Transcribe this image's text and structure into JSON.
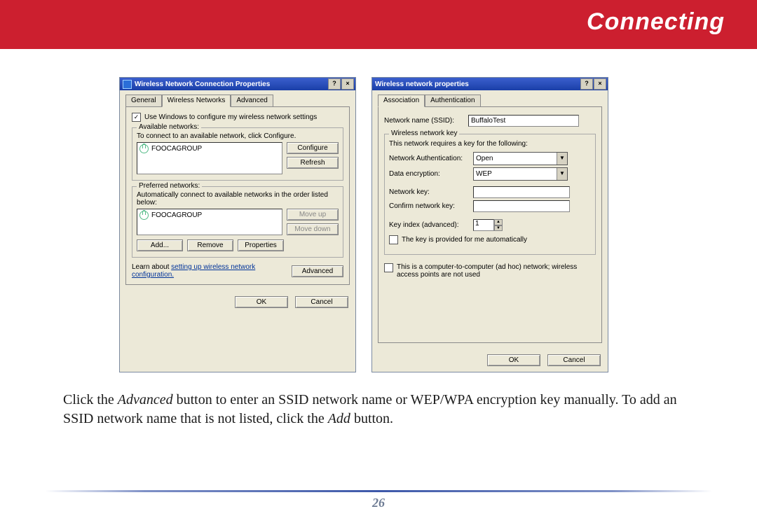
{
  "header": {
    "title": "Connecting"
  },
  "dialog1": {
    "title": "Wireless Network Connection Properties",
    "tabs": {
      "general": "General",
      "wireless": "Wireless Networks",
      "advanced": "Advanced"
    },
    "use_windows_label": "Use Windows to configure my wireless network settings",
    "available": {
      "group_title": "Available networks:",
      "hint": "To connect to an available network, click Configure.",
      "item": "FOOCAGROUP",
      "btn_configure": "Configure",
      "btn_refresh": "Refresh"
    },
    "preferred": {
      "group_title": "Preferred networks:",
      "hint": "Automatically connect to available networks in the order listed below:",
      "item": "FOOCAGROUP",
      "btn_moveup": "Move up",
      "btn_movedown": "Move down",
      "btn_add": "Add...",
      "btn_remove": "Remove",
      "btn_props": "Properties"
    },
    "learn_text": "Learn about ",
    "learn_link": "setting up wireless network configuration.",
    "btn_advanced": "Advanced",
    "btn_ok": "OK",
    "btn_cancel": "Cancel"
  },
  "dialog2": {
    "title": "Wireless network properties",
    "tabs": {
      "association": "Association",
      "auth": "Authentication"
    },
    "ssid_label": "Network name (SSID):",
    "ssid_value": "BuffaloTest",
    "keygroup": {
      "title": "Wireless network key",
      "hint": "This network requires a key for the following:",
      "auth_label": "Network Authentication:",
      "auth_value": "Open",
      "enc_label": "Data encryption:",
      "enc_value": "WEP",
      "netkey_label": "Network key:",
      "confirm_label": "Confirm network key:",
      "index_label": "Key index (advanced):",
      "index_value": "1",
      "auto_label": "The key is provided for me automatically"
    },
    "adhoc_label": "This is a computer-to-computer (ad hoc) network; wireless access points are not used",
    "btn_ok": "OK",
    "btn_cancel": "Cancel"
  },
  "caption": {
    "p1a": "Click the ",
    "p1b": "Advanced",
    "p1c": " button to enter an SSID network name or WEP/WPA encryption key manually.  To add an SSID network name that is not listed, click the ",
    "p1d": "Add",
    "p1e": " button."
  },
  "page_number": "26"
}
